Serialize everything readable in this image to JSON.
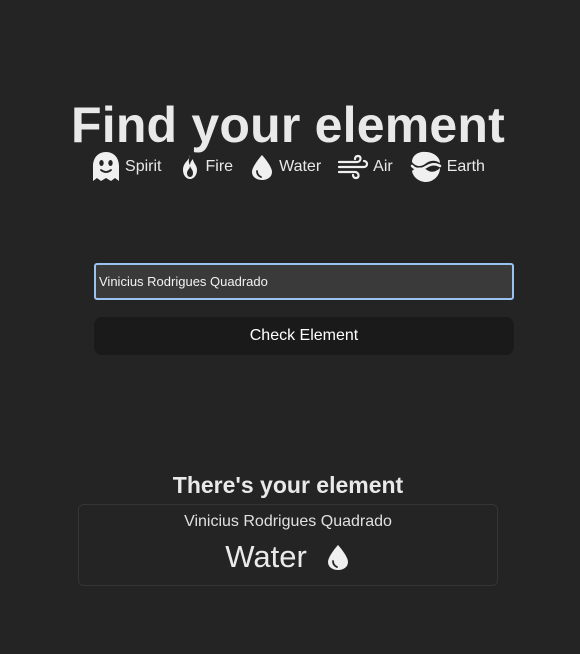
{
  "page": {
    "title": "Find your element"
  },
  "elements": [
    {
      "label": "Spirit",
      "icon": "ghost-icon"
    },
    {
      "label": "Fire",
      "icon": "fire-icon"
    },
    {
      "label": "Water",
      "icon": "water-drop-icon"
    },
    {
      "label": "Air",
      "icon": "wind-icon"
    },
    {
      "label": "Earth",
      "icon": "earth-waves-icon"
    }
  ],
  "form": {
    "name_value": "Vinicius Rodrigues Quadrado",
    "button_label": "Check Element"
  },
  "result": {
    "heading": "There's your element",
    "name": "Vinicius Rodrigues Quadrado",
    "element": "Water",
    "icon": "water-drop-icon"
  },
  "colors": {
    "background": "#242424",
    "text": "#e9e9e9",
    "input_border": "#9cc3f0",
    "button_bg": "#1a1a1a"
  }
}
